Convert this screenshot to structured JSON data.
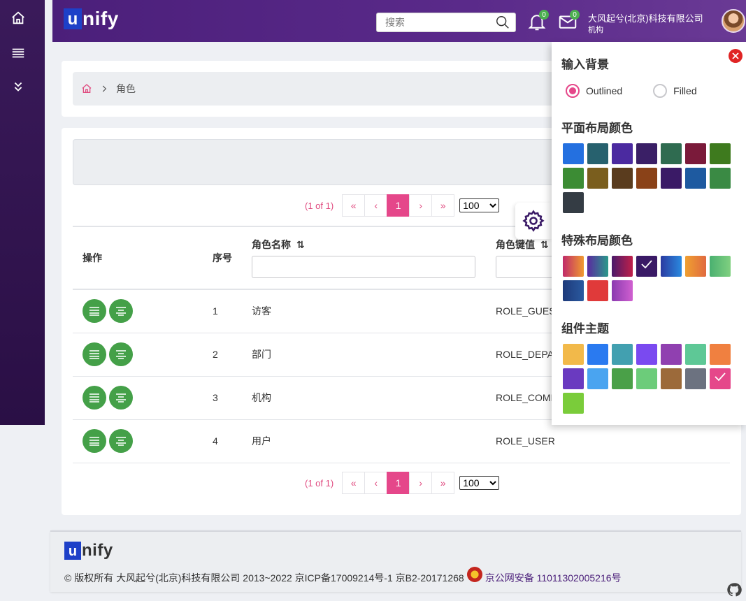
{
  "app": {
    "logo_u": "u",
    "logo_rest": "nify"
  },
  "topbar": {
    "search_placeholder": "搜索",
    "notifications_count": "0",
    "messages_count": "0",
    "company_name": "大风起兮(北京)科技有限公司",
    "user_role": "机构"
  },
  "breadcrumb": {
    "current": "角色"
  },
  "pagination": {
    "status": "(1 of 1)",
    "first": "«",
    "prev": "‹",
    "page": "1",
    "next": "›",
    "last": "»",
    "rows_per_page": "100",
    "rows_options": [
      "100"
    ]
  },
  "table": {
    "columns": {
      "actions": "操作",
      "index": "序号",
      "role_name": "角色名称",
      "role_key": "角色键值"
    },
    "sort_glyph": "⇅",
    "rows": [
      {
        "index": "1",
        "name": "访客",
        "key": "ROLE_GUEST"
      },
      {
        "index": "2",
        "name": "部门",
        "key": "ROLE_DEPAR"
      },
      {
        "index": "3",
        "name": "机构",
        "key": "ROLE_COMP"
      },
      {
        "index": "4",
        "name": "用户",
        "key": "ROLE_USER"
      }
    ]
  },
  "config": {
    "input_bg_title": "输入背景",
    "outlined_label": "Outlined",
    "filled_label": "Filled",
    "selected_input_style": "Outlined",
    "flat_title": "平面布局颜色",
    "flat_colors": [
      "#2470e0",
      "#27616e",
      "#4b2aa0",
      "#3a1f66",
      "#2f6b50",
      "#7a1a3a",
      "#3e7a1e",
      "#3c8c34",
      "#7a5e1e",
      "#5a3c1e",
      "#8a4218",
      "#3a1a66",
      "#1e5aa0",
      "#3a8a44",
      "#343c44"
    ],
    "special_title": "特殊布局颜色",
    "special_colors": [
      "linear-gradient(90deg,#c02a6a,#f09a30)",
      "linear-gradient(90deg,#5a2aa0,#2a9a8a)",
      "linear-gradient(90deg,#4a1a6a,#c0204a)",
      "#3a1a66",
      "linear-gradient(90deg,#2a3aa0,#2a8ae0)",
      "linear-gradient(90deg,#f0a030,#e06a40)",
      "linear-gradient(90deg,#4ab070,#80d080)",
      "linear-gradient(90deg,#1e3a7a,#2a5aa0)",
      "#e03a3a",
      "linear-gradient(90deg,#8a3ab0,#d060d0)"
    ],
    "special_selected_index": 3,
    "component_title": "组件主题",
    "component_colors": [
      "#f2b94a",
      "#2a7af0",
      "#42a0b0",
      "#7a4af0",
      "#9040b0",
      "#5ec896",
      "#f08040",
      "#6a3ac0",
      "#4aa4f0",
      "#4aa048",
      "#6ccc7a",
      "#9c6a3a",
      "#6c7280",
      "#e5478a",
      "#7acc3a"
    ],
    "component_selected_index": 13
  },
  "footer": {
    "logo_u": "u",
    "logo_rest": "nify",
    "copyright": "© 版权所有 大风起兮(北京)科技有限公司 2013~2022 京ICP备17009214号-1 京B2-20171268",
    "police_link": "京公网安备 11011302005216号"
  }
}
